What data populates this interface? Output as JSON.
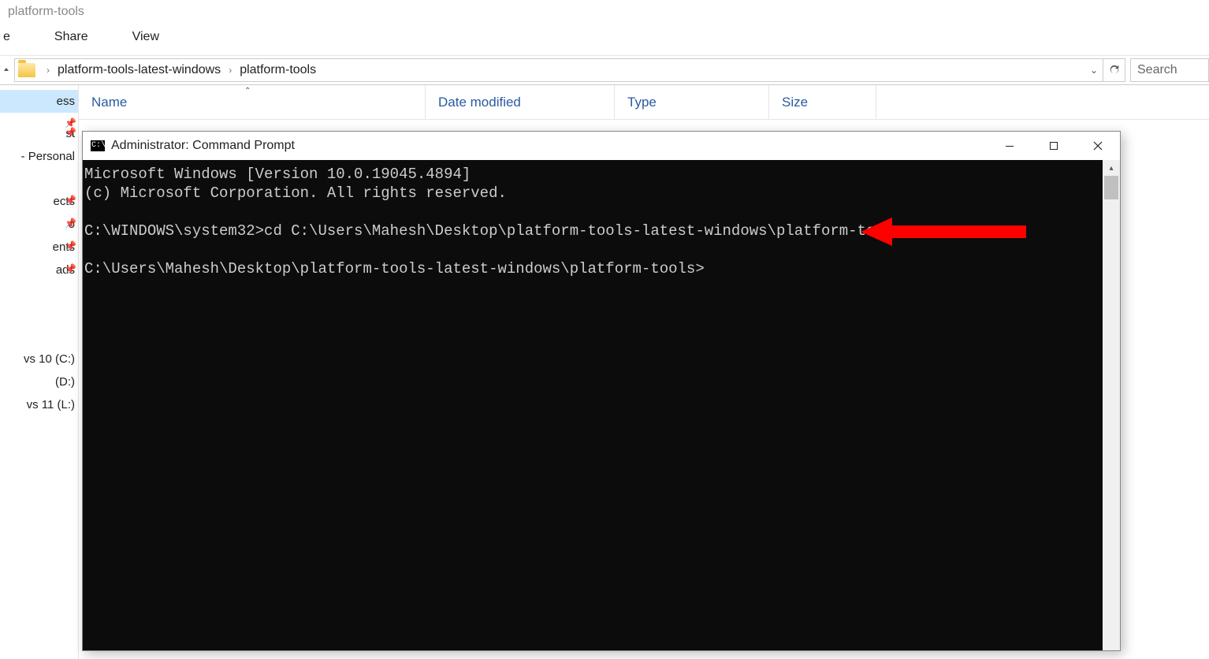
{
  "explorer": {
    "title": "platform-tools",
    "tabs": {
      "a": "e",
      "share": "Share",
      "view": "View"
    },
    "breadcrumb": {
      "a": "platform-tools-latest-windows",
      "b": "platform-tools"
    },
    "search_placeholder": "Search",
    "columns": {
      "name": "Name",
      "date": "Date modified",
      "type": "Type",
      "size": "Size"
    }
  },
  "sidebar": {
    "items": [
      {
        "label": "ess",
        "selected": true,
        "pin": false
      },
      {
        "label": "",
        "pin": true
      },
      {
        "label": "st",
        "pin": true
      },
      {
        "label": " - Personal",
        "pin": false
      },
      {
        "label": "ects",
        "pin": true
      },
      {
        "label": "o",
        "pin": true
      },
      {
        "label": "ents",
        "pin": true
      },
      {
        "label": "ads",
        "pin": true
      },
      {
        "label": "vs 10 (C:)",
        "pin": false
      },
      {
        "label": " (D:)",
        "pin": false
      },
      {
        "label": "vs 11 (L:)",
        "pin": false
      }
    ]
  },
  "cmd": {
    "title": "Administrator: Command Prompt",
    "line1": "Microsoft Windows [Version 10.0.19045.4894]",
    "line2": "(c) Microsoft Corporation. All rights reserved.",
    "prompt1": "C:\\WINDOWS\\system32>cd C:\\Users\\Mahesh\\Desktop\\platform-tools-latest-windows\\platform-tools",
    "prompt2": "C:\\Users\\Mahesh\\Desktop\\platform-tools-latest-windows\\platform-tools>"
  }
}
